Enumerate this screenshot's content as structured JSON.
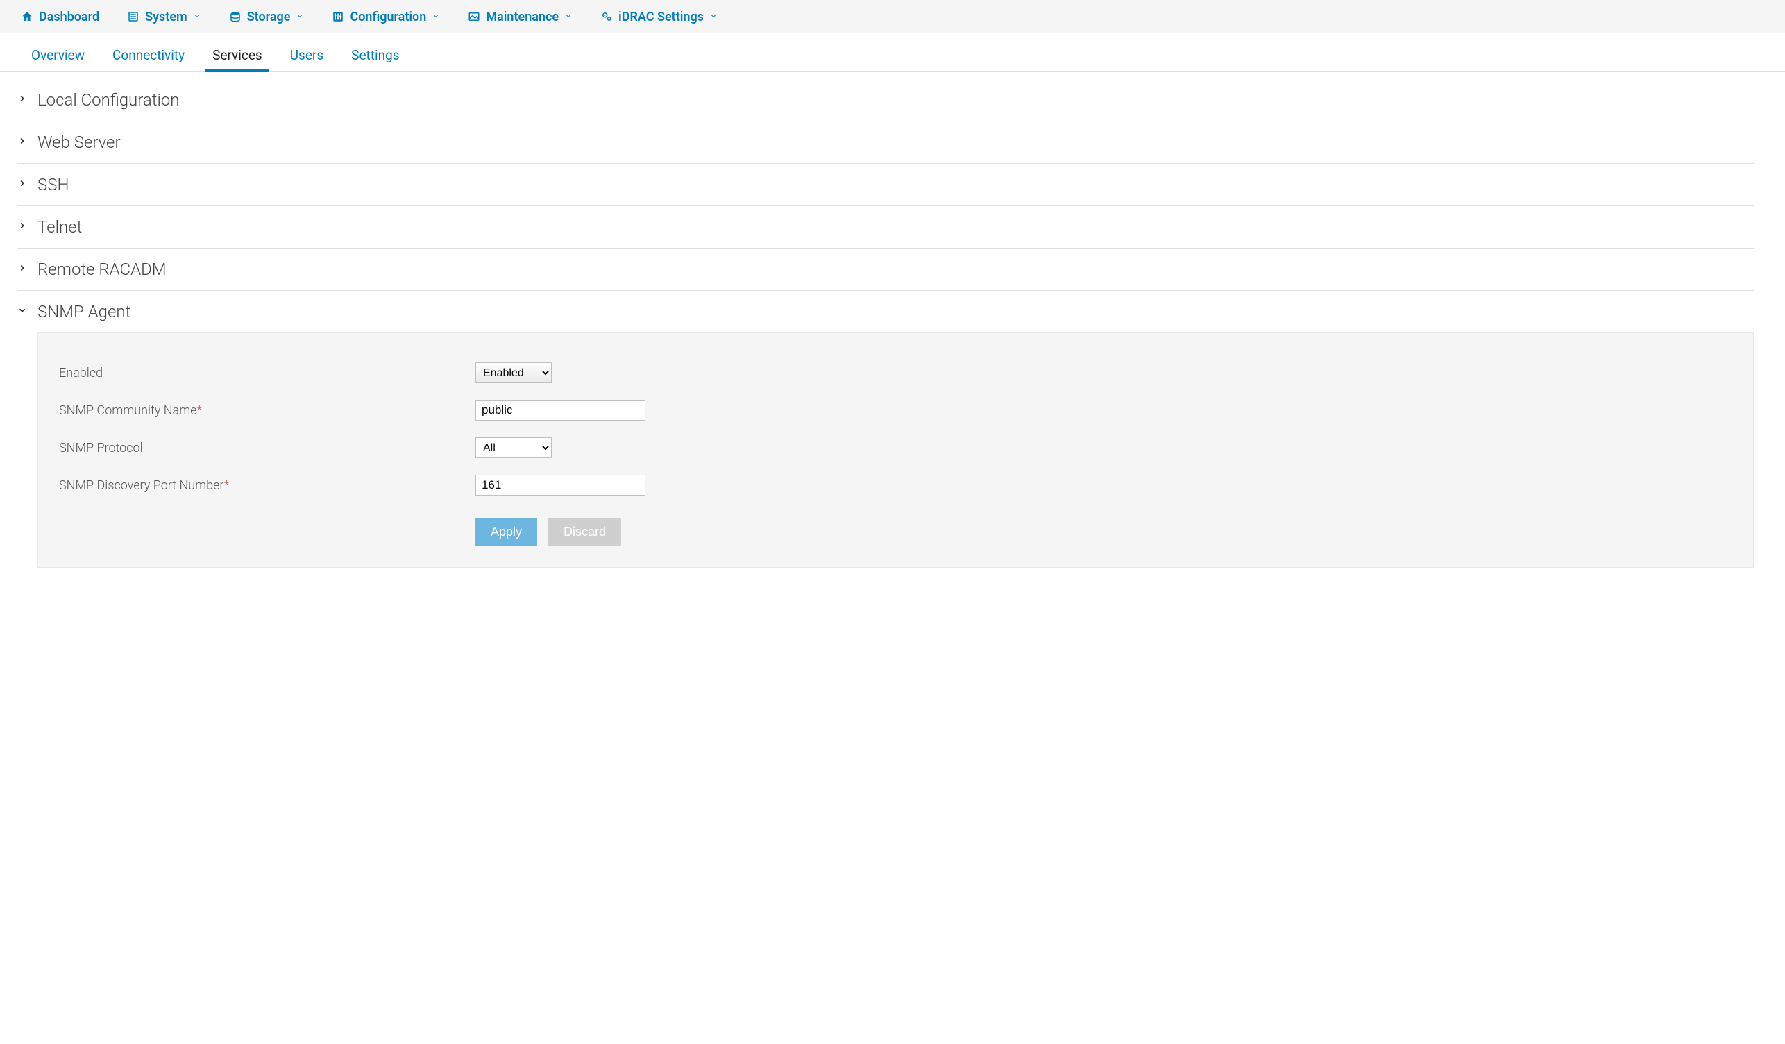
{
  "topnav": [
    {
      "label": "Dashboard",
      "icon": "home",
      "dropdown": false
    },
    {
      "label": "System",
      "icon": "list",
      "dropdown": true
    },
    {
      "label": "Storage",
      "icon": "database",
      "dropdown": true
    },
    {
      "label": "Configuration",
      "icon": "sliders",
      "dropdown": true
    },
    {
      "label": "Maintenance",
      "icon": "image",
      "dropdown": true
    },
    {
      "label": "iDRAC Settings",
      "icon": "gears",
      "dropdown": true
    }
  ],
  "subtabs": {
    "items": [
      "Overview",
      "Connectivity",
      "Services",
      "Users",
      "Settings"
    ],
    "active_index": 2
  },
  "sections": {
    "local_configuration": "Local Configuration",
    "web_server": "Web Server",
    "ssh": "SSH",
    "telnet": "Telnet",
    "remote_racadm": "Remote RACADM",
    "snmp_agent": "SNMP Agent"
  },
  "snmp": {
    "labels": {
      "enabled": "Enabled",
      "community_name": "SNMP Community Name",
      "protocol": "SNMP Protocol",
      "discovery_port": "SNMP Discovery Port Number"
    },
    "values": {
      "enabled": "Enabled",
      "community_name": "public",
      "protocol": "All",
      "discovery_port": "161"
    },
    "buttons": {
      "apply": "Apply",
      "discard": "Discard"
    }
  }
}
